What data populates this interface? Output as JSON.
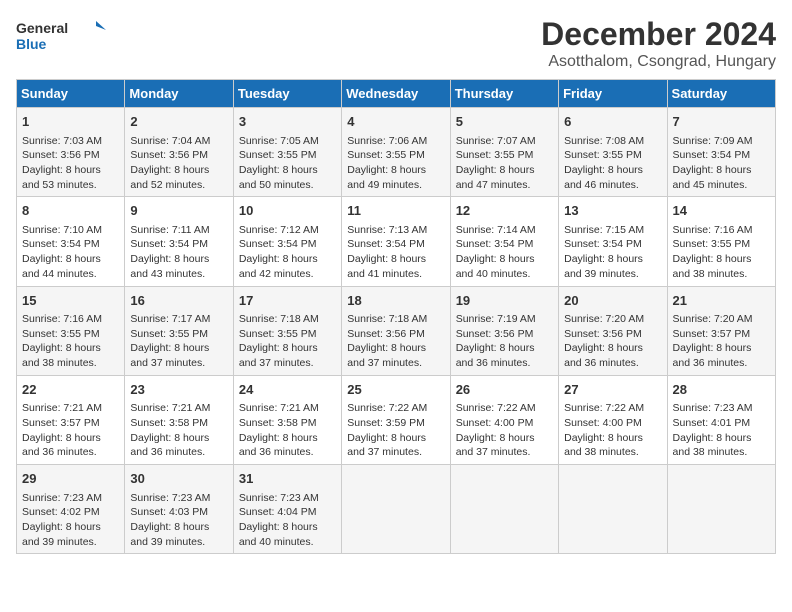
{
  "header": {
    "logo_general": "General",
    "logo_blue": "Blue",
    "month": "December 2024",
    "location": "Asotthalom, Csongrad, Hungary"
  },
  "days_of_week": [
    "Sunday",
    "Monday",
    "Tuesday",
    "Wednesday",
    "Thursday",
    "Friday",
    "Saturday"
  ],
  "weeks": [
    [
      {
        "day": "1",
        "sunrise": "Sunrise: 7:03 AM",
        "sunset": "Sunset: 3:56 PM",
        "daylight": "Daylight: 8 hours and 53 minutes."
      },
      {
        "day": "2",
        "sunrise": "Sunrise: 7:04 AM",
        "sunset": "Sunset: 3:56 PM",
        "daylight": "Daylight: 8 hours and 52 minutes."
      },
      {
        "day": "3",
        "sunrise": "Sunrise: 7:05 AM",
        "sunset": "Sunset: 3:55 PM",
        "daylight": "Daylight: 8 hours and 50 minutes."
      },
      {
        "day": "4",
        "sunrise": "Sunrise: 7:06 AM",
        "sunset": "Sunset: 3:55 PM",
        "daylight": "Daylight: 8 hours and 49 minutes."
      },
      {
        "day": "5",
        "sunrise": "Sunrise: 7:07 AM",
        "sunset": "Sunset: 3:55 PM",
        "daylight": "Daylight: 8 hours and 47 minutes."
      },
      {
        "day": "6",
        "sunrise": "Sunrise: 7:08 AM",
        "sunset": "Sunset: 3:55 PM",
        "daylight": "Daylight: 8 hours and 46 minutes."
      },
      {
        "day": "7",
        "sunrise": "Sunrise: 7:09 AM",
        "sunset": "Sunset: 3:54 PM",
        "daylight": "Daylight: 8 hours and 45 minutes."
      }
    ],
    [
      {
        "day": "8",
        "sunrise": "Sunrise: 7:10 AM",
        "sunset": "Sunset: 3:54 PM",
        "daylight": "Daylight: 8 hours and 44 minutes."
      },
      {
        "day": "9",
        "sunrise": "Sunrise: 7:11 AM",
        "sunset": "Sunset: 3:54 PM",
        "daylight": "Daylight: 8 hours and 43 minutes."
      },
      {
        "day": "10",
        "sunrise": "Sunrise: 7:12 AM",
        "sunset": "Sunset: 3:54 PM",
        "daylight": "Daylight: 8 hours and 42 minutes."
      },
      {
        "day": "11",
        "sunrise": "Sunrise: 7:13 AM",
        "sunset": "Sunset: 3:54 PM",
        "daylight": "Daylight: 8 hours and 41 minutes."
      },
      {
        "day": "12",
        "sunrise": "Sunrise: 7:14 AM",
        "sunset": "Sunset: 3:54 PM",
        "daylight": "Daylight: 8 hours and 40 minutes."
      },
      {
        "day": "13",
        "sunrise": "Sunrise: 7:15 AM",
        "sunset": "Sunset: 3:54 PM",
        "daylight": "Daylight: 8 hours and 39 minutes."
      },
      {
        "day": "14",
        "sunrise": "Sunrise: 7:16 AM",
        "sunset": "Sunset: 3:55 PM",
        "daylight": "Daylight: 8 hours and 38 minutes."
      }
    ],
    [
      {
        "day": "15",
        "sunrise": "Sunrise: 7:16 AM",
        "sunset": "Sunset: 3:55 PM",
        "daylight": "Daylight: 8 hours and 38 minutes."
      },
      {
        "day": "16",
        "sunrise": "Sunrise: 7:17 AM",
        "sunset": "Sunset: 3:55 PM",
        "daylight": "Daylight: 8 hours and 37 minutes."
      },
      {
        "day": "17",
        "sunrise": "Sunrise: 7:18 AM",
        "sunset": "Sunset: 3:55 PM",
        "daylight": "Daylight: 8 hours and 37 minutes."
      },
      {
        "day": "18",
        "sunrise": "Sunrise: 7:18 AM",
        "sunset": "Sunset: 3:56 PM",
        "daylight": "Daylight: 8 hours and 37 minutes."
      },
      {
        "day": "19",
        "sunrise": "Sunrise: 7:19 AM",
        "sunset": "Sunset: 3:56 PM",
        "daylight": "Daylight: 8 hours and 36 minutes."
      },
      {
        "day": "20",
        "sunrise": "Sunrise: 7:20 AM",
        "sunset": "Sunset: 3:56 PM",
        "daylight": "Daylight: 8 hours and 36 minutes."
      },
      {
        "day": "21",
        "sunrise": "Sunrise: 7:20 AM",
        "sunset": "Sunset: 3:57 PM",
        "daylight": "Daylight: 8 hours and 36 minutes."
      }
    ],
    [
      {
        "day": "22",
        "sunrise": "Sunrise: 7:21 AM",
        "sunset": "Sunset: 3:57 PM",
        "daylight": "Daylight: 8 hours and 36 minutes."
      },
      {
        "day": "23",
        "sunrise": "Sunrise: 7:21 AM",
        "sunset": "Sunset: 3:58 PM",
        "daylight": "Daylight: 8 hours and 36 minutes."
      },
      {
        "day": "24",
        "sunrise": "Sunrise: 7:21 AM",
        "sunset": "Sunset: 3:58 PM",
        "daylight": "Daylight: 8 hours and 36 minutes."
      },
      {
        "day": "25",
        "sunrise": "Sunrise: 7:22 AM",
        "sunset": "Sunset: 3:59 PM",
        "daylight": "Daylight: 8 hours and 37 minutes."
      },
      {
        "day": "26",
        "sunrise": "Sunrise: 7:22 AM",
        "sunset": "Sunset: 4:00 PM",
        "daylight": "Daylight: 8 hours and 37 minutes."
      },
      {
        "day": "27",
        "sunrise": "Sunrise: 7:22 AM",
        "sunset": "Sunset: 4:00 PM",
        "daylight": "Daylight: 8 hours and 38 minutes."
      },
      {
        "day": "28",
        "sunrise": "Sunrise: 7:23 AM",
        "sunset": "Sunset: 4:01 PM",
        "daylight": "Daylight: 8 hours and 38 minutes."
      }
    ],
    [
      {
        "day": "29",
        "sunrise": "Sunrise: 7:23 AM",
        "sunset": "Sunset: 4:02 PM",
        "daylight": "Daylight: 8 hours and 39 minutes."
      },
      {
        "day": "30",
        "sunrise": "Sunrise: 7:23 AM",
        "sunset": "Sunset: 4:03 PM",
        "daylight": "Daylight: 8 hours and 39 minutes."
      },
      {
        "day": "31",
        "sunrise": "Sunrise: 7:23 AM",
        "sunset": "Sunset: 4:04 PM",
        "daylight": "Daylight: 8 hours and 40 minutes."
      },
      null,
      null,
      null,
      null
    ]
  ]
}
